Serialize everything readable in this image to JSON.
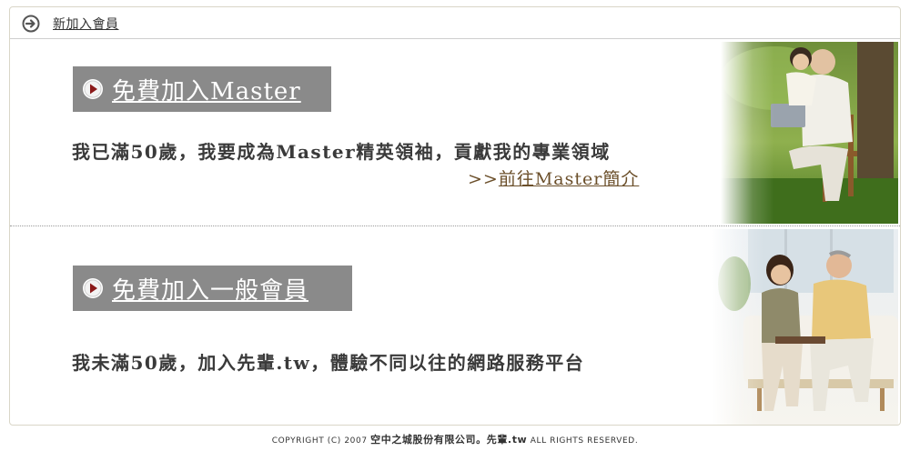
{
  "header": {
    "title": "新加入會員",
    "icon": "arrow-circle-icon"
  },
  "master": {
    "button_label": "免費加入Master",
    "description": "我已滿50歲，我要成為Master精英領袖，貢獻我的專業領域",
    "more_prefix": ">>",
    "more_link": "前往Master簡介",
    "image": "senior-couple-outdoor-photo"
  },
  "general": {
    "button_label": "免費加入一般會員",
    "description": "我未滿50歲，加入先輩.tw，體驗不同以往的網路服務平台",
    "image": "senior-couple-sofa-photo"
  },
  "footer": {
    "prefix": "COPYRIGHT (C) 2007 ",
    "brand": "空中之城股份有限公司。先輩.tw",
    "suffix": " ALL RIGHTS RESERVED."
  },
  "colors": {
    "button_bg": "#8a8a8a",
    "play_icon": "#8b1a1a",
    "link_brown": "#6b4f2a",
    "border": "#d9d6c8"
  }
}
